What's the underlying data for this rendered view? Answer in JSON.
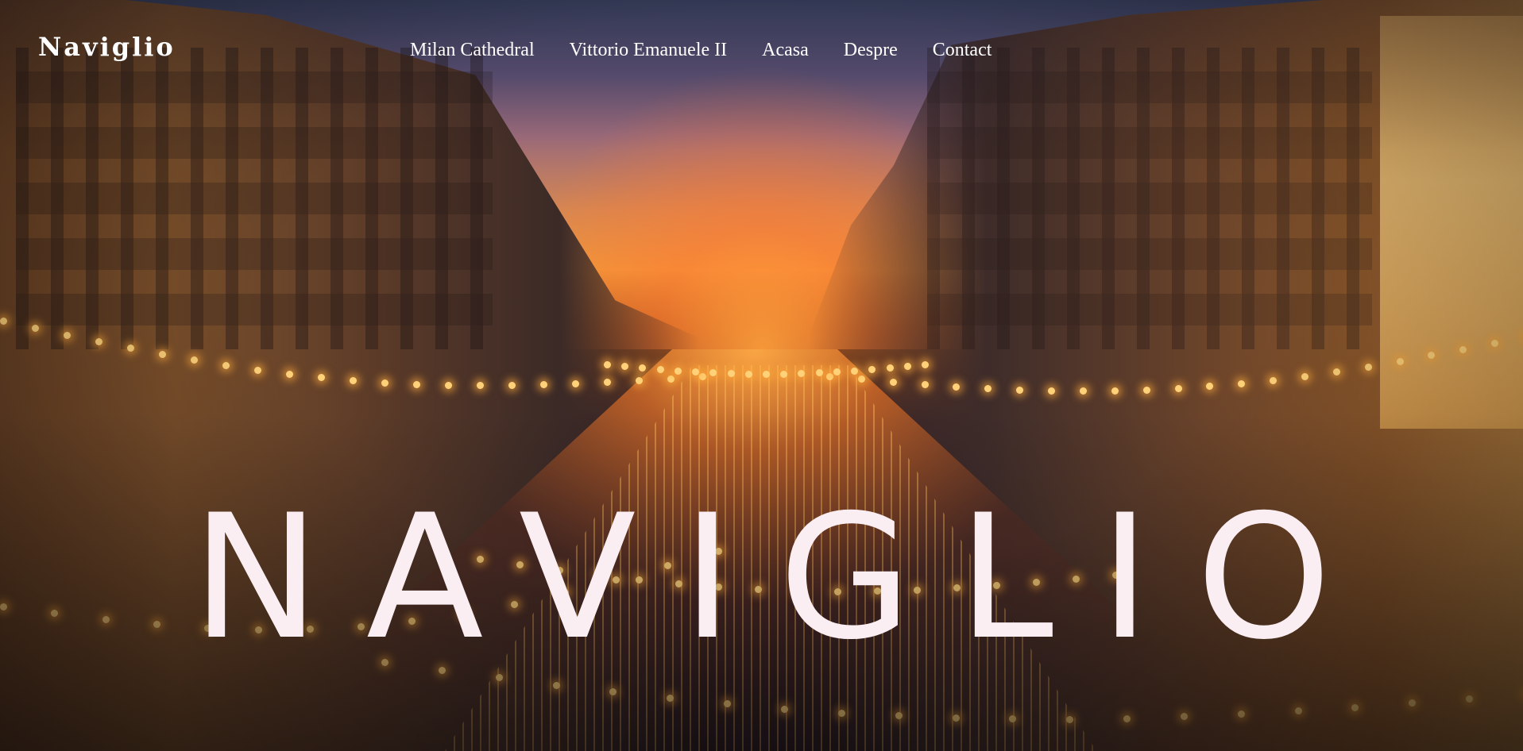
{
  "header": {
    "brand": "Naviglio",
    "nav": [
      {
        "label": "Milan Cathedral"
      },
      {
        "label": "Vittorio Emanuele II"
      },
      {
        "label": "Acasa"
      },
      {
        "label": "Despre"
      },
      {
        "label": "Contact"
      }
    ]
  },
  "hero": {
    "title": "NAVIGLIO",
    "background": "night-canal-photo",
    "colors": {
      "text": "#ffffff",
      "title": "#fbeef2",
      "sky_orange": "#f0993a",
      "sky_purple": "#5e5275"
    }
  }
}
